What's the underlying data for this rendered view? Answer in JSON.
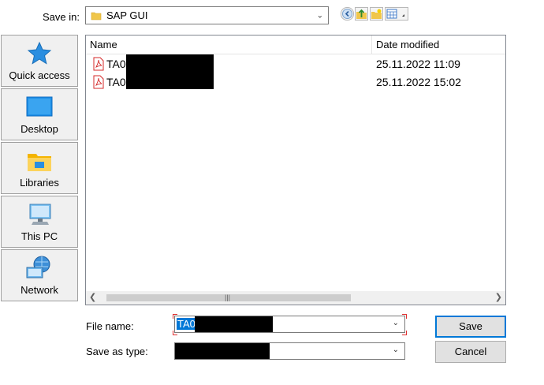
{
  "save_in": {
    "label": "Save in:",
    "folder": "SAP GUI",
    "icons": [
      "back-icon",
      "up-folder-icon",
      "new-folder-icon",
      "view-menu-icon"
    ]
  },
  "places": [
    {
      "label": "Quick access",
      "icon": "quick-access-star-icon"
    },
    {
      "label": "Desktop",
      "icon": "desktop-icon"
    },
    {
      "label": "Libraries",
      "icon": "libraries-icon"
    },
    {
      "label": "This PC",
      "icon": "this-pc-icon"
    },
    {
      "label": "Network",
      "icon": "network-icon"
    }
  ],
  "file_list": {
    "columns": [
      "Name",
      "Date modified"
    ],
    "rows": [
      {
        "name": "TA0",
        "date": "25.11.2022 11:09",
        "icon": "pdf-icon"
      },
      {
        "name": "TA0",
        "date": "25.11.2022 15:02",
        "icon": "pdf-icon"
      }
    ]
  },
  "file_name": {
    "label": "File name:",
    "value": "TA0"
  },
  "save_as_type": {
    "label": "Save as type:",
    "value": ""
  },
  "buttons": {
    "save": "Save",
    "cancel": "Cancel"
  }
}
